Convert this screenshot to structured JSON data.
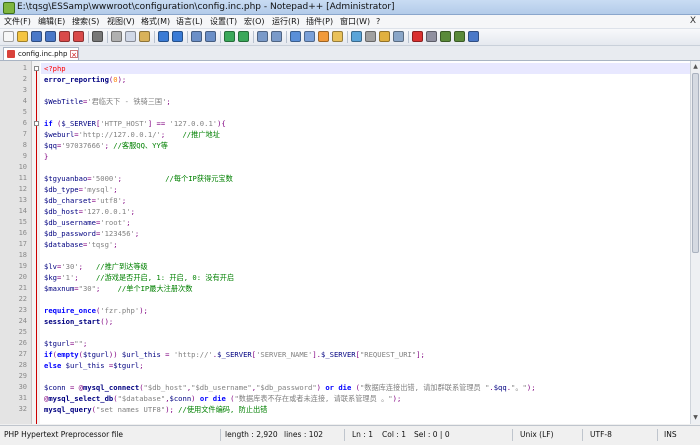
{
  "window": {
    "title": "E:\\tqsg\\ESSamp\\wwwroot\\configuration\\config.inc.php - Notepad++ [Administrator]"
  },
  "menu": [
    "文件(F)",
    "编辑(E)",
    "搜索(S)",
    "视图(V)",
    "格式(M)",
    "语言(L)",
    "设置(T)",
    "宏(O)",
    "运行(R)",
    "插件(P)",
    "窗口(W)",
    "?"
  ],
  "menu_close": "X",
  "toolbar": {
    "icons": [
      "new-file-icon",
      "open-file-icon",
      "save-icon",
      "save-all-icon",
      "close-icon",
      "close-all-icon",
      "print-icon",
      "cut-icon",
      "copy-icon",
      "paste-icon",
      "undo-icon",
      "redo-icon",
      "find-icon",
      "replace-icon",
      "zoom-in-icon",
      "zoom-out-icon",
      "sync-v-icon",
      "sync-h-icon",
      "word-wrap-icon",
      "show-all-chars-icon",
      "indent-guide-icon",
      "user-lang-icon",
      "doc-map-icon",
      "function-list-icon",
      "folder-workspace-icon",
      "monitor-icon",
      "record-macro-icon",
      "stop-macro-icon",
      "play-macro-icon",
      "run-macro-multiple-icon",
      "save-macro-icon"
    ]
  },
  "tab": {
    "label": "config.inc.php",
    "close": "×"
  },
  "editor": {
    "lines": [
      [
        [
          "php",
          "<?php"
        ]
      ],
      [
        [
          "fn",
          "error_reporting"
        ],
        [
          "op",
          "("
        ],
        [
          "num",
          "0"
        ],
        [
          "op",
          ");"
        ]
      ],
      [],
      [
        [
          "var",
          "$WebTitle"
        ],
        [
          "op",
          "="
        ],
        [
          "str",
          "'君临天下 - 铁骑三国'"
        ],
        [
          "op",
          ";"
        ]
      ],
      [],
      [
        [
          "kw",
          "if"
        ],
        [
          "op",
          " ("
        ],
        [
          "var",
          "$_SERVER"
        ],
        [
          "op",
          "["
        ],
        [
          "str",
          "'HTTP_HOST'"
        ],
        [
          "op",
          "] == "
        ],
        [
          "str",
          "'127.0.0.1'"
        ],
        [
          "op",
          "){"
        ]
      ],
      [
        [
          "var",
          "$weburl"
        ],
        [
          "op",
          "="
        ],
        [
          "str",
          "'http://127.0.0.1/'"
        ],
        [
          "op",
          ";    "
        ],
        [
          "cm",
          "//推广地址"
        ]
      ],
      [
        [
          "var",
          "$qq"
        ],
        [
          "op",
          "="
        ],
        [
          "str",
          "'97037666'"
        ],
        [
          "op",
          "; "
        ],
        [
          "cm",
          "//客服QQ、YY等"
        ]
      ],
      [
        [
          "op",
          "}"
        ]
      ],
      [],
      [
        [
          "var",
          "$tgyuanbao"
        ],
        [
          "op",
          "="
        ],
        [
          "str",
          "'5000'"
        ],
        [
          "op",
          ";          "
        ],
        [
          "cm",
          "//每个IP获得元宝数"
        ]
      ],
      [
        [
          "var",
          "$db_type"
        ],
        [
          "op",
          "="
        ],
        [
          "str",
          "'mysql'"
        ],
        [
          "op",
          ";"
        ]
      ],
      [
        [
          "var",
          "$db_charset"
        ],
        [
          "op",
          "="
        ],
        [
          "str",
          "'utf8'"
        ],
        [
          "op",
          ";"
        ]
      ],
      [
        [
          "var",
          "$db_host"
        ],
        [
          "op",
          "="
        ],
        [
          "str",
          "'127.0.0.1'"
        ],
        [
          "op",
          ";"
        ]
      ],
      [
        [
          "var",
          "$db_username"
        ],
        [
          "op",
          "="
        ],
        [
          "str",
          "'root'"
        ],
        [
          "op",
          ";"
        ]
      ],
      [
        [
          "var",
          "$db_password"
        ],
        [
          "op",
          "="
        ],
        [
          "str",
          "'123456'"
        ],
        [
          "op",
          ";"
        ]
      ],
      [
        [
          "var",
          "$database"
        ],
        [
          "op",
          "="
        ],
        [
          "str",
          "'tqsg'"
        ],
        [
          "op",
          ";"
        ]
      ],
      [],
      [
        [
          "var",
          "$lv"
        ],
        [
          "op",
          "="
        ],
        [
          "str",
          "'30'"
        ],
        [
          "op",
          ";   "
        ],
        [
          "cm",
          "//推广到达等级"
        ]
      ],
      [
        [
          "var",
          "$kg"
        ],
        [
          "op",
          "="
        ],
        [
          "str",
          "'1'"
        ],
        [
          "op",
          ";    "
        ],
        [
          "cm",
          "//游戏是否开启, 1: 开启, 0: 没有开启"
        ]
      ],
      [
        [
          "var",
          "$maxnum"
        ],
        [
          "op",
          "="
        ],
        [
          "str",
          "\"30\""
        ],
        [
          "op",
          ";    "
        ],
        [
          "cm",
          "//单个IP最大注册次数"
        ]
      ],
      [],
      [
        [
          "kw",
          "require_once"
        ],
        [
          "op",
          "("
        ],
        [
          "str",
          "'fzr.php'"
        ],
        [
          "op",
          ");"
        ]
      ],
      [
        [
          "fn",
          "session_start"
        ],
        [
          "op",
          "();"
        ]
      ],
      [],
      [
        [
          "var",
          "$tgurl"
        ],
        [
          "op",
          "="
        ],
        [
          "str",
          "\"\""
        ],
        [
          "op",
          ";"
        ]
      ],
      [
        [
          "kw",
          "if"
        ],
        [
          "op",
          "("
        ],
        [
          "kw",
          "empty"
        ],
        [
          "op",
          "("
        ],
        [
          "var",
          "$tgurl"
        ],
        [
          "op",
          ")) "
        ],
        [
          "var",
          "$url_this"
        ],
        [
          "op",
          " = "
        ],
        [
          "str",
          "'http://'"
        ],
        [
          "op",
          "."
        ],
        [
          "var",
          "$_SERVER"
        ],
        [
          "op",
          "["
        ],
        [
          "str",
          "'SERVER_NAME'"
        ],
        [
          "op",
          "]."
        ],
        [
          "var",
          "$_SERVER"
        ],
        [
          "op",
          "["
        ],
        [
          "str",
          "\"REQUEST_URI\""
        ],
        [
          "op",
          "];"
        ]
      ],
      [
        [
          "kw",
          "else"
        ],
        [
          "op",
          " "
        ],
        [
          "var",
          "$url_this"
        ],
        [
          "op",
          " ="
        ],
        [
          "var",
          "$tgurl"
        ],
        [
          "op",
          ";"
        ]
      ],
      [],
      [
        [
          "var",
          "$conn"
        ],
        [
          "op",
          " = @"
        ],
        [
          "fn",
          "mysql_connect"
        ],
        [
          "op",
          "("
        ],
        [
          "str",
          "\"$db_host\""
        ],
        [
          "op",
          ","
        ],
        [
          "str",
          "\"$db_username\""
        ],
        [
          "op",
          ","
        ],
        [
          "str",
          "\"$db_password\""
        ],
        [
          "op",
          ") "
        ],
        [
          "kw",
          "or"
        ],
        [
          "op",
          " "
        ],
        [
          "kw",
          "die"
        ],
        [
          "op",
          " ("
        ],
        [
          "str",
          "\"数据库连接出错, 请加群联系管理员 \""
        ],
        [
          "op",
          "."
        ],
        [
          "var",
          "$qq"
        ],
        [
          "op",
          "."
        ],
        [
          "str",
          "\"。\""
        ],
        [
          "op",
          ");"
        ]
      ],
      [
        [
          "op",
          "@"
        ],
        [
          "fn",
          "mysql_select_db"
        ],
        [
          "op",
          "("
        ],
        [
          "str",
          "\"$database\""
        ],
        [
          "op",
          ","
        ],
        [
          "var",
          "$conn"
        ],
        [
          "op",
          ") "
        ],
        [
          "kw",
          "or"
        ],
        [
          "op",
          " "
        ],
        [
          "kw",
          "die"
        ],
        [
          "op",
          " ("
        ],
        [
          "str",
          "\"数据库表不存在或者未连接, 请联系管理员 。\""
        ],
        [
          "op",
          ");"
        ]
      ],
      [
        [
          "fn",
          "mysql_query"
        ],
        [
          "op",
          "("
        ],
        [
          "str",
          "\"set names UTF8\""
        ],
        [
          "op",
          "); "
        ],
        [
          "cm",
          "//使用文件编码, 防止出错"
        ]
      ]
    ]
  },
  "status": {
    "lang": "PHP Hypertext Preprocessor file",
    "length": "length : 2,920",
    "lines": "lines : 102",
    "ln": "Ln : 1",
    "col": "Col : 1",
    "sel": "Sel : 0 | 0",
    "eol": "Unix (LF)",
    "encoding": "UTF-8",
    "ins": "INS"
  },
  "colors": {
    "keyword": "#0000ff",
    "variable": "#000080",
    "string": "#808080",
    "comment": "#008000",
    "number": "#ff8000",
    "php_tag": "#ff0000"
  }
}
